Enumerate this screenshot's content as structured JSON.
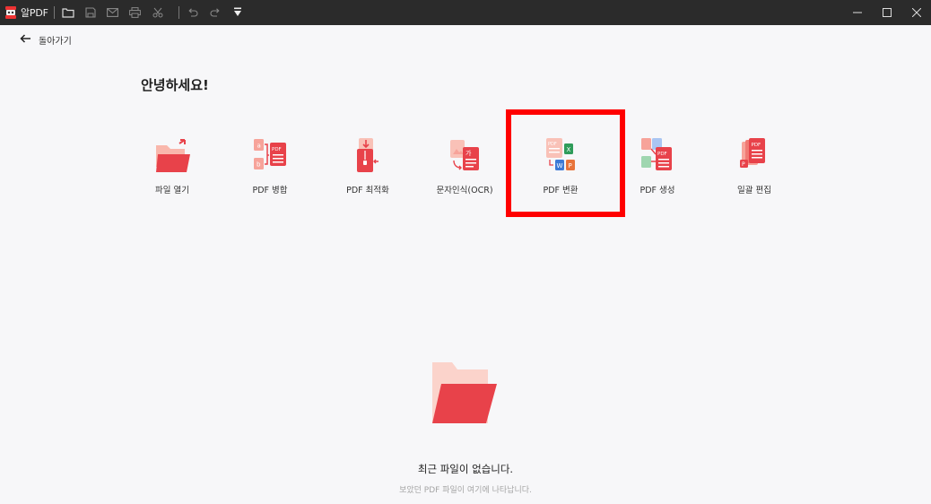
{
  "app": {
    "name": "알PDF"
  },
  "toolbar_icons": [
    "folder-open-icon",
    "save-icon",
    "mail-icon",
    "print-icon",
    "scissors-icon",
    "undo-icon",
    "redo-icon",
    "download-arrow-icon"
  ],
  "window_controls": [
    "minimize-icon",
    "maximize-icon",
    "close-icon"
  ],
  "nav": {
    "back_label": "돌아가기"
  },
  "greeting": "안녕하세요!",
  "tools": [
    {
      "id": "open-file",
      "label": "파일 열기",
      "icon": "open-folder-icon"
    },
    {
      "id": "merge",
      "label": "PDF 병합",
      "icon": "merge-pdf-icon"
    },
    {
      "id": "optimize",
      "label": "PDF 최적화",
      "icon": "compress-pdf-icon"
    },
    {
      "id": "ocr",
      "label": "문자인식(OCR)",
      "icon": "ocr-icon"
    },
    {
      "id": "convert",
      "label": "PDF 변환",
      "icon": "convert-pdf-icon",
      "highlighted": true
    },
    {
      "id": "create",
      "label": "PDF 생성",
      "icon": "create-pdf-icon"
    },
    {
      "id": "batch",
      "label": "일괄 편집",
      "icon": "batch-edit-icon"
    }
  ],
  "icon_text": {
    "pdf": "PDF",
    "ga": "가",
    "a": "a",
    "b": "b",
    "x": "X",
    "w": "W",
    "p": "P"
  },
  "empty_state": {
    "title": "최근 파일이 없습니다.",
    "subtitle": "보았던 PDF 파일이 여기에 나타납니다."
  },
  "colors": {
    "accent": "#e8424a",
    "accent_light": "#f7a39a",
    "highlight": "#ff0000",
    "titlebar": "#2b2b2b"
  }
}
